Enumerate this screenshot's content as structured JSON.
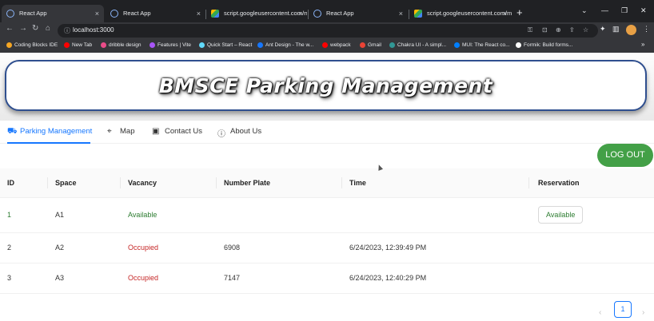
{
  "browser": {
    "tabs": [
      {
        "title": "React App",
        "icon": "react-favicon"
      },
      {
        "title": "React App",
        "icon": "react-favicon"
      },
      {
        "title": "script.googleusercontent.com/m",
        "icon": "gsc-favicon"
      },
      {
        "title": "React App",
        "icon": "react-favicon"
      },
      {
        "title": "script.googleusercontent.com/m",
        "icon": "gsc-favicon"
      }
    ],
    "tab_close": "×",
    "new_tab": "+",
    "url": "localhost:3000",
    "bookmarks": [
      {
        "label": "Coding Blocks IDE",
        "color": "#f5a623"
      },
      {
        "label": "New Tab",
        "color": "#ff0000"
      },
      {
        "label": "dribble design",
        "color": "#ea4c89"
      },
      {
        "label": "Features | Vite",
        "color": "#a855f7"
      },
      {
        "label": "Quick Start – React",
        "color": "#61dafb"
      },
      {
        "label": "Ant Design - The w...",
        "color": "#1677ff"
      },
      {
        "label": "webpack",
        "color": "#ff0000"
      },
      {
        "label": "Gmail",
        "color": "#ea4335"
      },
      {
        "label": "Chakra UI - A simpl...",
        "color": "#319795"
      },
      {
        "label": "MUI: The React co...",
        "color": "#007fff"
      },
      {
        "label": "Formik: Build forms...",
        "color": "#ffffff"
      }
    ],
    "bookmarks_more": "»"
  },
  "header": {
    "title": "BMSCE Parking Management"
  },
  "nav": {
    "tabs": [
      {
        "label": "Parking Management",
        "icon": "car-icon",
        "glyph": "⛟"
      },
      {
        "label": "Map",
        "icon": "location-pin-icon",
        "glyph": "⌖"
      },
      {
        "label": "Contact Us",
        "icon": "contact-card-icon",
        "glyph": "▣"
      },
      {
        "label": "About Us",
        "icon": "info-icon",
        "glyph": "ⓘ"
      }
    ]
  },
  "actions": {
    "logout_label": "LOG OUT"
  },
  "table": {
    "columns": [
      "ID",
      "Space",
      "Vacancy",
      "Number Plate",
      "Time",
      "Reservation"
    ],
    "rows": [
      {
        "id": "1",
        "space": "A1",
        "vacancy": "Available",
        "plate": "",
        "time": "",
        "reservation": "Available"
      },
      {
        "id": "2",
        "space": "A2",
        "vacancy": "Occupied",
        "plate": "6908",
        "time": "6/24/2023, 12:39:49 PM",
        "reservation": ""
      },
      {
        "id": "3",
        "space": "A3",
        "vacancy": "Occupied",
        "plate": "7147",
        "time": "6/24/2023, 12:40:29 PM",
        "reservation": ""
      }
    ]
  },
  "pagination": {
    "current": "1",
    "prev": "‹",
    "next": "›"
  },
  "colors": {
    "accent": "#1677ff",
    "logout": "#43a047",
    "available": "#2e7d32",
    "occupied": "#c62828",
    "banner_border": "#2f4f8f"
  }
}
